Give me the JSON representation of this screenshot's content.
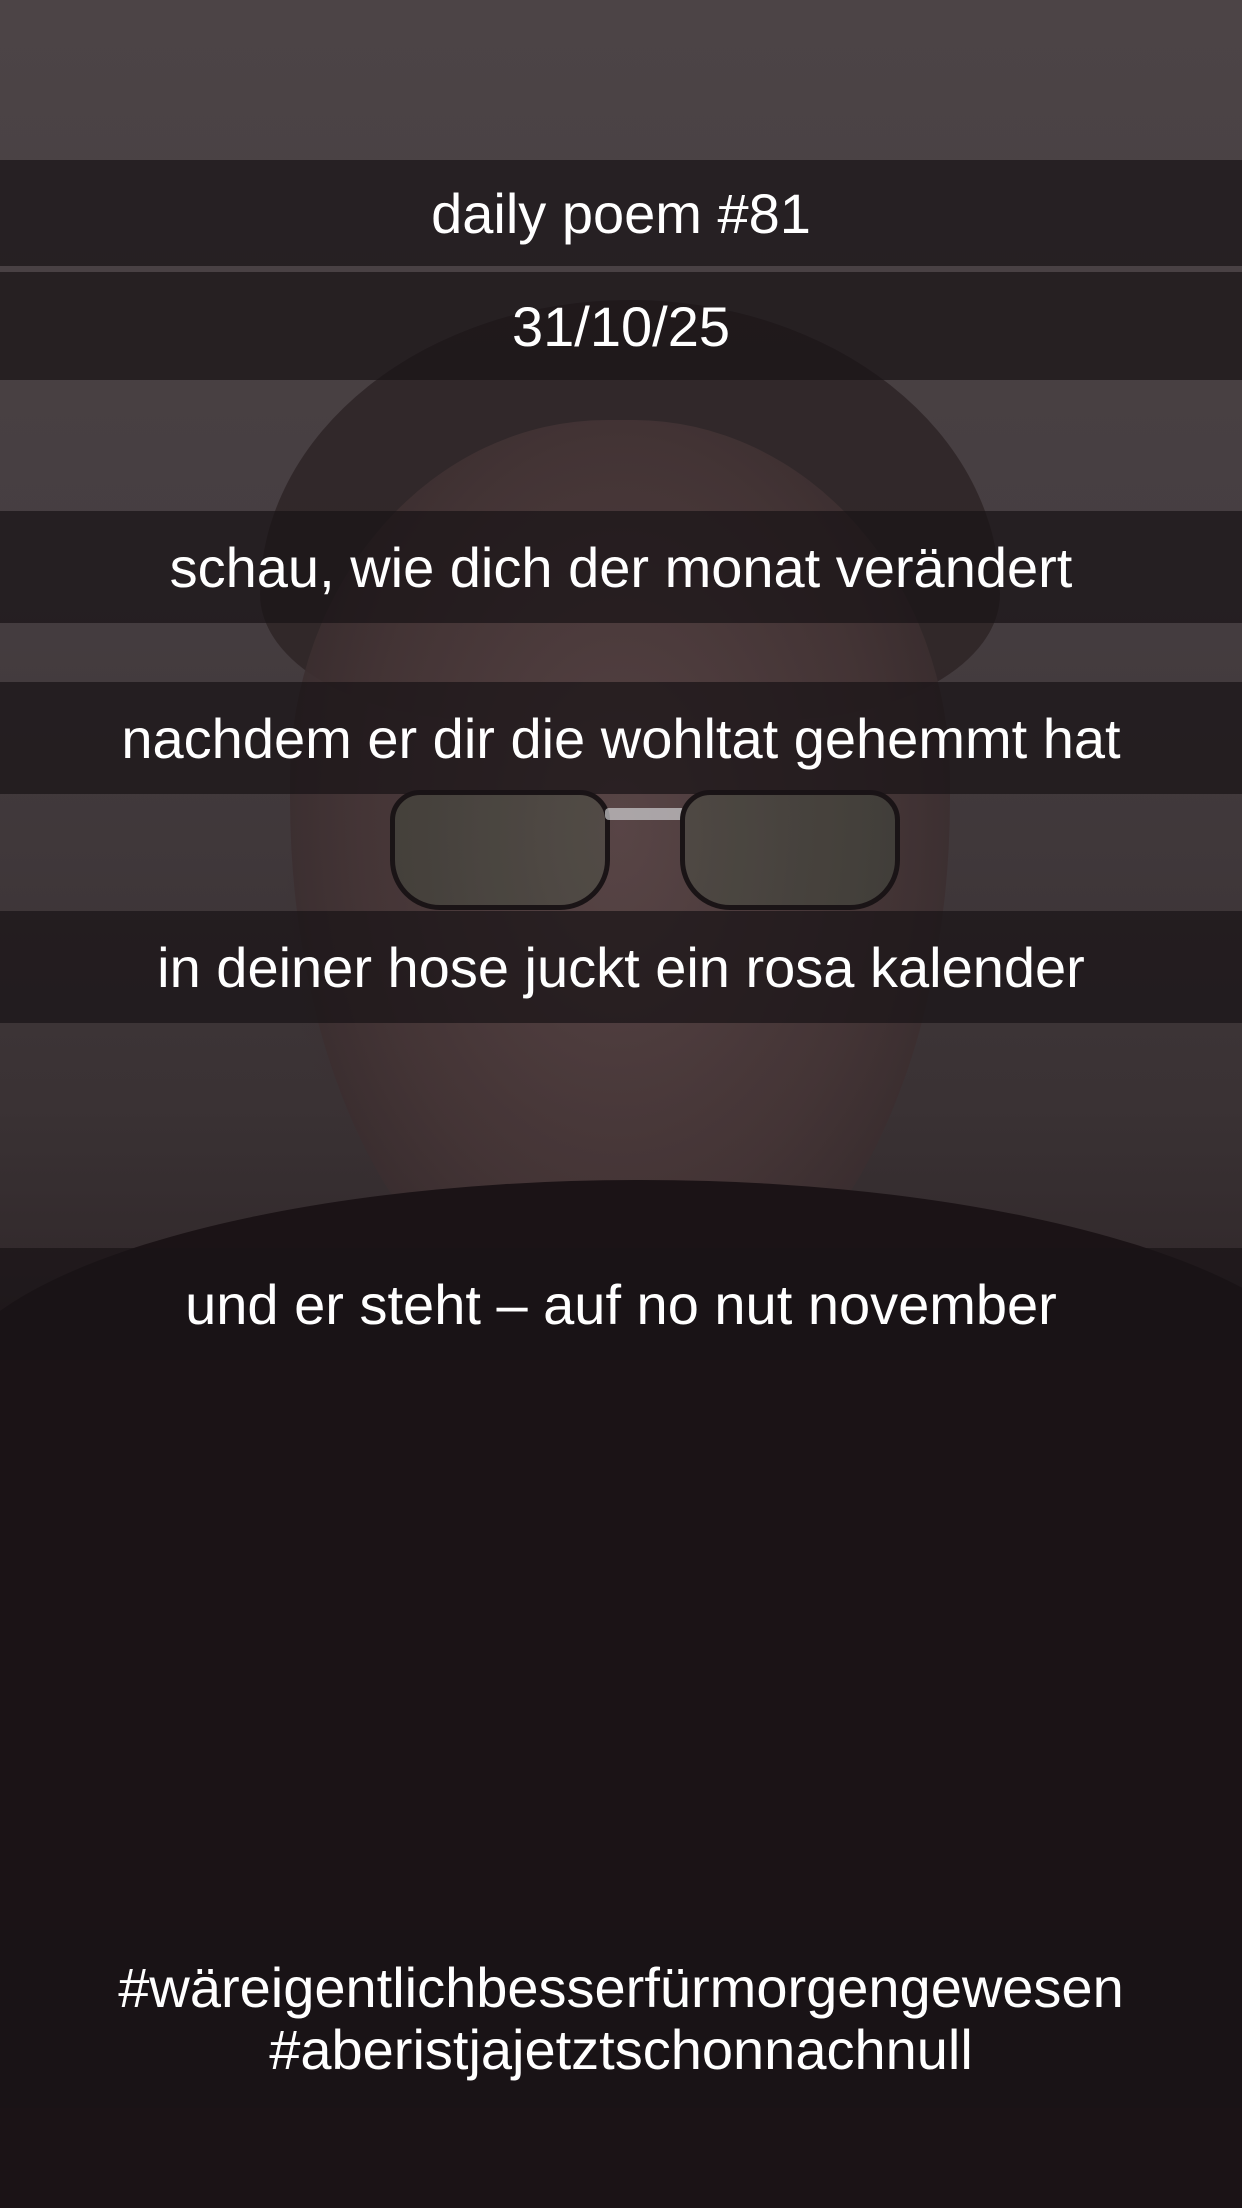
{
  "poem": {
    "title": "daily poem #81",
    "date": "31/10/25",
    "lines": [
      "schau, wie dich der monat verändert",
      "nachdem er dir die wohltat gehemmt hat",
      "in deiner hose juckt ein rosa kalender",
      "und er steht – auf no nut november"
    ]
  },
  "hashtags": [
    "#wäreigentlichbesserfürmorgengewesen",
    "#aberistjajetztschonnachnull"
  ],
  "colors": {
    "caption_text": "#ffffff",
    "caption_band": "#191416"
  }
}
